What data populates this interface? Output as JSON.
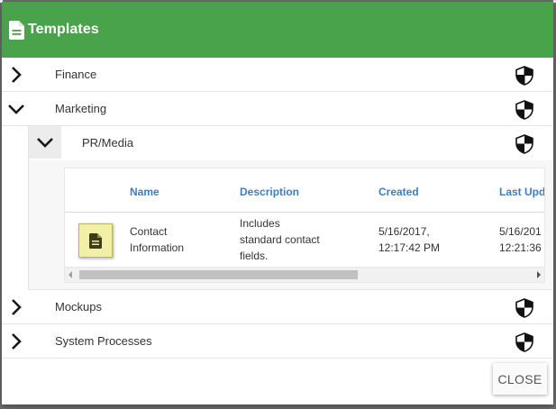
{
  "dialog": {
    "title": "Templates",
    "header_color": "#48a34a",
    "close_label": "CLOSE"
  },
  "tree": {
    "finance": {
      "label": "Finance",
      "expanded": false
    },
    "marketing": {
      "label": "Marketing",
      "expanded": true
    },
    "pr_media": {
      "label": "PR/Media",
      "expanded": true
    },
    "mockups": {
      "label": "Mockups",
      "expanded": false
    },
    "system_processes": {
      "label": "System Processes",
      "expanded": false
    }
  },
  "grid": {
    "columns": [
      "Name",
      "Description",
      "Created",
      "Last Upd"
    ],
    "rows": [
      {
        "name_line1": "Contact",
        "name_line2": "Information",
        "desc_line1": "Includes",
        "desc_line2": "standard contact",
        "desc_line3": "fields.",
        "created_line1": "5/16/2017,",
        "created_line2": "12:17:42 PM",
        "updated_line1": "5/16/201",
        "updated_line2": "12:21:36"
      }
    ]
  },
  "icons": {
    "header": "document-icon",
    "expand": "chevron-right-icon",
    "collapse": "chevron-down-icon",
    "permissions": "shield-icon",
    "template_row": "document-icon"
  },
  "colors": {
    "accent": "#48a34a",
    "link": "#3b7fc0",
    "doc_button": "#f2f0a6"
  }
}
